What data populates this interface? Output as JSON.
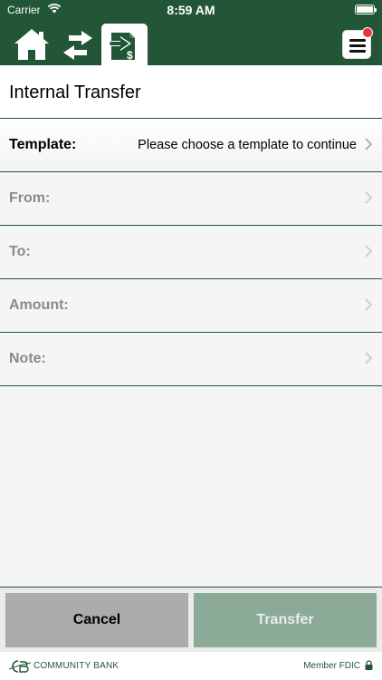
{
  "status_bar": {
    "carrier": "Carrier",
    "time": "8:59 AM"
  },
  "nav": {
    "icons": [
      "home-icon",
      "swap-arrows-icon",
      "transfer-dollar-icon",
      "hamburger-menu-icon"
    ],
    "accent_color": "#235636",
    "notification_color": "#e5343a"
  },
  "header": {
    "title": "Internal Transfer"
  },
  "form": {
    "rows": [
      {
        "label": "Template:",
        "value": "Please choose a template to continue"
      },
      {
        "label": "From:",
        "value": ""
      },
      {
        "label": "To:",
        "value": ""
      },
      {
        "label": "Amount:",
        "value": ""
      },
      {
        "label": "Note:",
        "value": ""
      }
    ]
  },
  "actions": {
    "cancel_label": "Cancel",
    "transfer_label": "Transfer"
  },
  "brand": {
    "name": "COMMUNITY BANK",
    "fdic": "Member FDIC"
  }
}
